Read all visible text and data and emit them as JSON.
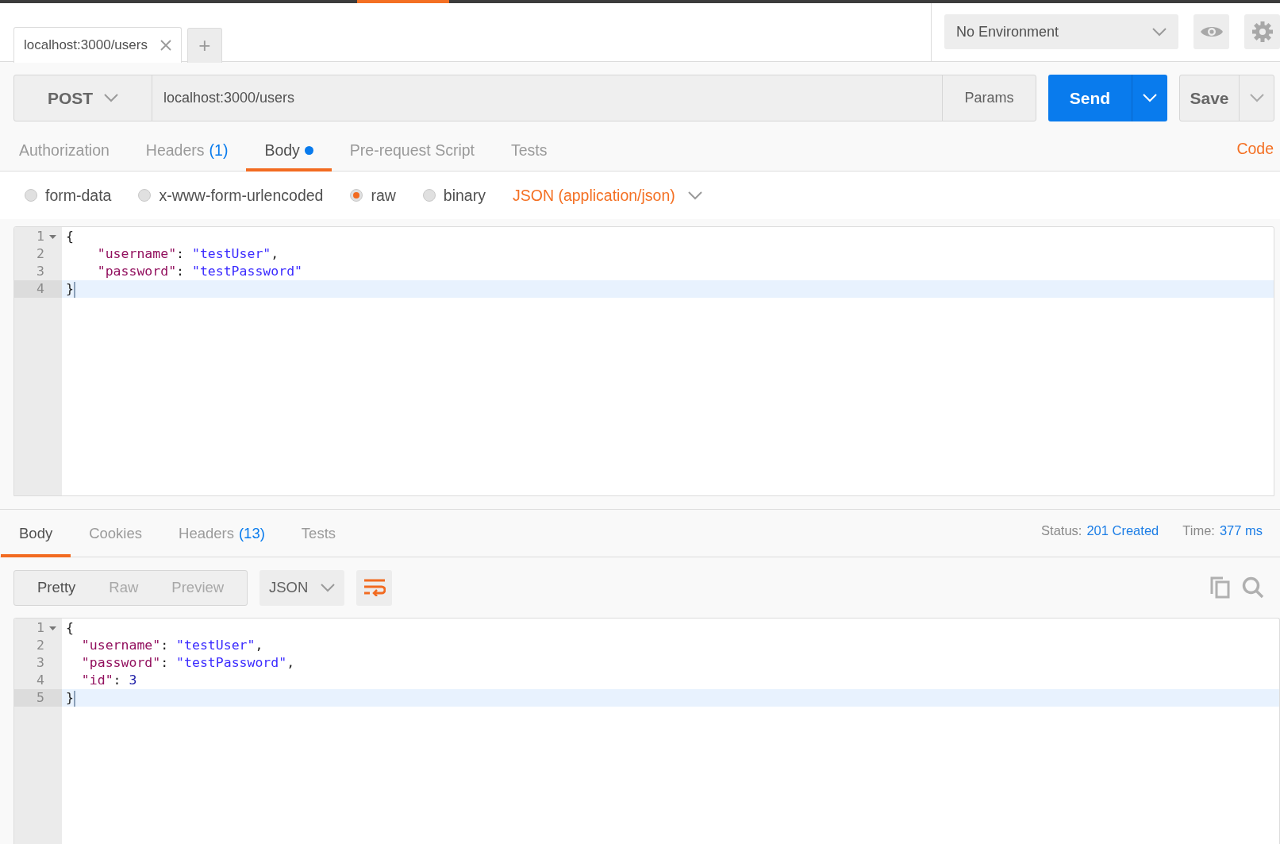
{
  "top_tabs": [
    {
      "label": "localhost:3000/users",
      "selected": true
    }
  ],
  "new_tab_button": "+",
  "environment": {
    "value": "No Environment"
  },
  "request": {
    "method": "POST",
    "url": "localhost:3000/users",
    "params_button": "Params",
    "send_button": "Send",
    "save_button": "Save"
  },
  "request_tabs": [
    {
      "label": "Authorization",
      "selected": false,
      "modified": false
    },
    {
      "label": "Headers",
      "count": "(1)",
      "selected": false,
      "modified": false
    },
    {
      "label": "Body",
      "selected": true,
      "modified": true
    },
    {
      "label": "Pre-request Script",
      "selected": false,
      "modified": false
    },
    {
      "label": "Tests",
      "selected": false,
      "modified": false
    }
  ],
  "code_link": "Code",
  "body_types": [
    {
      "label": "form-data",
      "selected": false
    },
    {
      "label": "x-www-form-urlencoded",
      "selected": false
    },
    {
      "label": "raw",
      "selected": true
    },
    {
      "label": "binary",
      "selected": false
    }
  ],
  "content_type": "JSON (application/json)",
  "request_editor": {
    "lines": [
      {
        "number": "1",
        "foldable": true,
        "active": false,
        "tokens": [
          {
            "kind": "punct",
            "text": "{"
          }
        ]
      },
      {
        "number": "2",
        "foldable": false,
        "active": false,
        "tokens": [
          {
            "kind": "key",
            "text": "    \"username\""
          },
          {
            "kind": "punct",
            "text": ": "
          },
          {
            "kind": "string",
            "text": "\"testUser\""
          },
          {
            "kind": "punct",
            "text": ","
          }
        ]
      },
      {
        "number": "3",
        "foldable": false,
        "active": false,
        "tokens": [
          {
            "kind": "key",
            "text": "    \"password\""
          },
          {
            "kind": "punct",
            "text": ": "
          },
          {
            "kind": "string",
            "text": "\"testPassword\""
          }
        ]
      },
      {
        "number": "4",
        "foldable": false,
        "active": true,
        "tokens": [
          {
            "kind": "punct",
            "text": "}"
          }
        ]
      }
    ]
  },
  "response_tabs": [
    {
      "label": "Body",
      "selected": true
    },
    {
      "label": "Cookies",
      "selected": false
    },
    {
      "label": "Headers",
      "count": "(13)",
      "selected": false
    },
    {
      "label": "Tests",
      "selected": false
    }
  ],
  "status": {
    "label": "Status:",
    "value": "201 Created"
  },
  "time": {
    "label": "Time:",
    "value": "377 ms"
  },
  "view_modes": [
    {
      "label": "Pretty",
      "selected": true
    },
    {
      "label": "Raw",
      "selected": false
    },
    {
      "label": "Preview",
      "selected": false
    }
  ],
  "format": "JSON",
  "response_editor": {
    "lines": [
      {
        "number": "1",
        "foldable": true,
        "active": false,
        "tokens": [
          {
            "kind": "punct",
            "text": "{"
          }
        ]
      },
      {
        "number": "2",
        "foldable": false,
        "active": false,
        "tokens": [
          {
            "kind": "key",
            "text": "  \"username\""
          },
          {
            "kind": "punct",
            "text": ": "
          },
          {
            "kind": "string",
            "text": "\"testUser\""
          },
          {
            "kind": "punct",
            "text": ","
          }
        ]
      },
      {
        "number": "3",
        "foldable": false,
        "active": false,
        "tokens": [
          {
            "kind": "key",
            "text": "  \"password\""
          },
          {
            "kind": "punct",
            "text": ": "
          },
          {
            "kind": "string",
            "text": "\"testPassword\""
          },
          {
            "kind": "punct",
            "text": ","
          }
        ]
      },
      {
        "number": "4",
        "foldable": false,
        "active": false,
        "tokens": [
          {
            "kind": "key",
            "text": "  \"id\""
          },
          {
            "kind": "punct",
            "text": ": "
          },
          {
            "kind": "number",
            "text": "3"
          }
        ]
      },
      {
        "number": "5",
        "foldable": false,
        "active": true,
        "tokens": [
          {
            "kind": "punct",
            "text": "}"
          }
        ]
      }
    ]
  }
}
